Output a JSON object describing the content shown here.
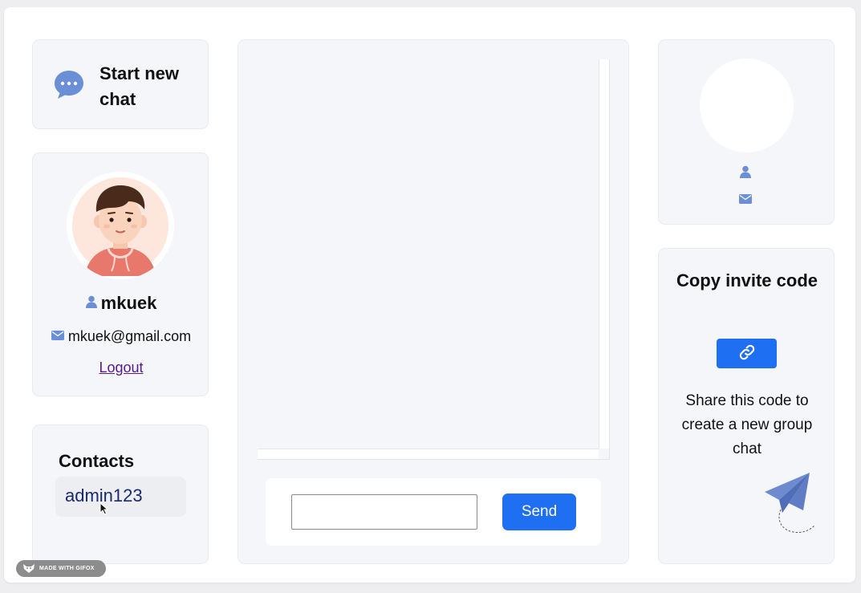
{
  "left": {
    "new_chat_label": "Start new chat",
    "profile": {
      "username": "mkuek",
      "email": "mkuek@gmail.com",
      "logout_label": "Logout"
    },
    "contacts": {
      "title": "Contacts",
      "items": [
        {
          "name": "admin123"
        }
      ]
    }
  },
  "chat": {
    "message_input_value": "",
    "send_label": "Send"
  },
  "right": {
    "invite_title": "Copy invite code",
    "share_text": "Share this code to create a new group chat"
  },
  "watermark": "MADE WITH GIFOX",
  "colors": {
    "accent": "#1f6ff2",
    "card_bg": "#f5f6f9",
    "icon_blue": "#6b8fd6",
    "logout_link": "#551a8b"
  },
  "icons": {
    "new_chat": "chat-bubble-icon",
    "user": "user-icon",
    "mail": "mail-icon",
    "copy": "link-icon",
    "decoration": "paper-plane-icon"
  }
}
